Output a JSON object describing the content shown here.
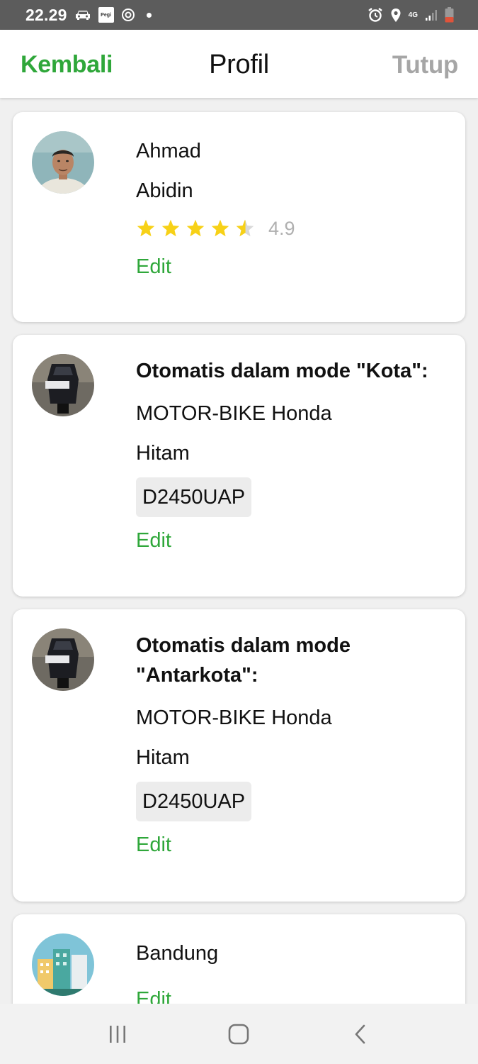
{
  "status_bar": {
    "time": "22.29",
    "pegi_label": "Pegi",
    "network": "4G"
  },
  "header": {
    "back_label": "Kembali",
    "title": "Profil",
    "close_label": "Tutup"
  },
  "profile": {
    "first_name": "Ahmad",
    "last_name": "Abidin",
    "rating": 4.9,
    "rating_text": "4.9",
    "edit_label": "Edit"
  },
  "vehicles": [
    {
      "mode_title": "Otomatis dalam mode \"Kota\":",
      "vehicle": "MOTOR-BIKE Honda",
      "color": "Hitam",
      "plate": "D2450UAP",
      "edit_label": "Edit"
    },
    {
      "mode_title": "Otomatis dalam mode \"Antarkota\":",
      "vehicle": "MOTOR-BIKE Honda",
      "color": "Hitam",
      "plate": "D2450UAP",
      "edit_label": "Edit"
    }
  ],
  "city": {
    "name": "Bandung",
    "edit_label": "Edit"
  },
  "colors": {
    "accent_green": "#2fa73a",
    "star_yellow": "#f7d117",
    "muted_gray": "#a6a6a6"
  }
}
